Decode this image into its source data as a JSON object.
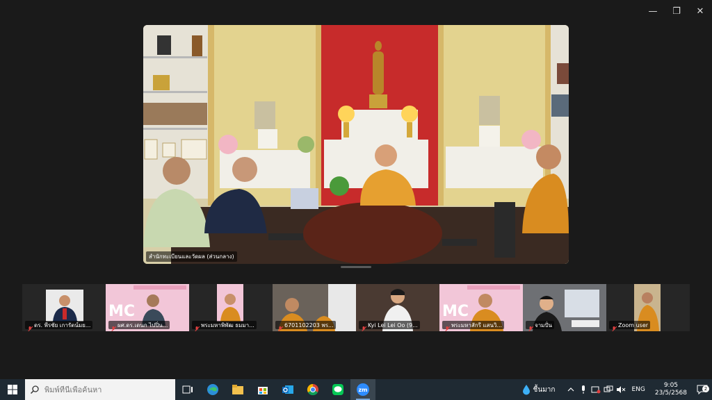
{
  "window": {
    "minimize_glyph": "—",
    "restore_glyph": "❐",
    "close_glyph": "✕"
  },
  "main_video": {
    "label": "สำนักทะเบียนและวัดผล (ส่วนกลาง)"
  },
  "gallery": [
    {
      "name": "ดร. พีรชัย เการัตน์มย...",
      "bg": "#2b2b2b"
    },
    {
      "name": "ผศ.ดร.เดนก ไปปิ่น...",
      "bg": "#f2c6d8"
    },
    {
      "name": "พระมหาพิพัฒ ธมมา...",
      "bg": "#2e2e2e"
    },
    {
      "name": "6701102203  พร...",
      "bg": "#4a4a4a"
    },
    {
      "name": "Kyi  Lei  Lei  Oo (9...",
      "bg": "#3a2f2a"
    },
    {
      "name": "พระมหาสักรี แสนวิ...",
      "bg": "#f2c6d8"
    },
    {
      "name": "จามปั่น",
      "bg": "#5a5a5a"
    },
    {
      "name": "Zoom user",
      "bg": "#2a2a2a"
    }
  ],
  "taskbar": {
    "search_placeholder": "พิมพ์ที่นี่เพื่อค้นหา",
    "weather_text": "ชื้นมาก",
    "language": "ENG",
    "time": "9:05",
    "date": "23/5/2568",
    "notification_count": "2",
    "zoom_label": "zm"
  },
  "colors": {
    "background": "#1a1a1a",
    "taskbar": "#1f2a33",
    "mic_off": "#e04040"
  }
}
